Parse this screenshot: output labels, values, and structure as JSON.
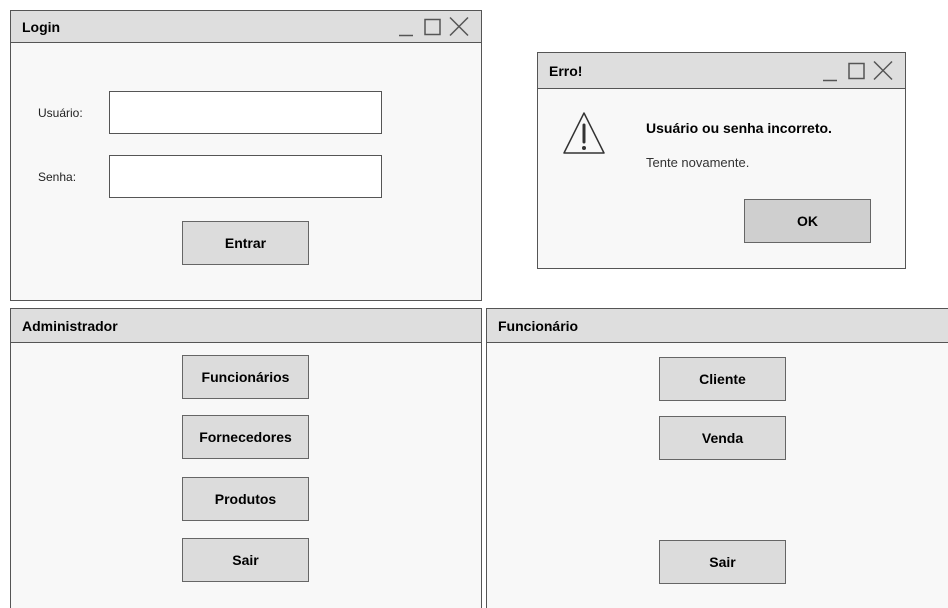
{
  "login": {
    "title": "Login",
    "username_label": "Usuário:",
    "password_label": "Senha:",
    "submit_label": "Entrar"
  },
  "error": {
    "title": "Erro!",
    "message": "Usuário ou senha incorreto.",
    "detail": "Tente novamente.",
    "ok_label": "OK"
  },
  "admin": {
    "title": "Administrador",
    "buttons": [
      "Funcionários",
      "Fornecedores",
      "Produtos",
      "Sair"
    ]
  },
  "employee": {
    "title": "Funcionário",
    "buttons": [
      "Cliente",
      "Venda",
      "Sair"
    ]
  },
  "window_controls": [
    "minimize-icon",
    "maximize-icon",
    "close-icon"
  ],
  "colors": {
    "titlebar": "#dedede",
    "window": "#f8f8f8",
    "button": "#dcdcdc",
    "ok_button": "#cfcfcf",
    "border": "#555555"
  }
}
